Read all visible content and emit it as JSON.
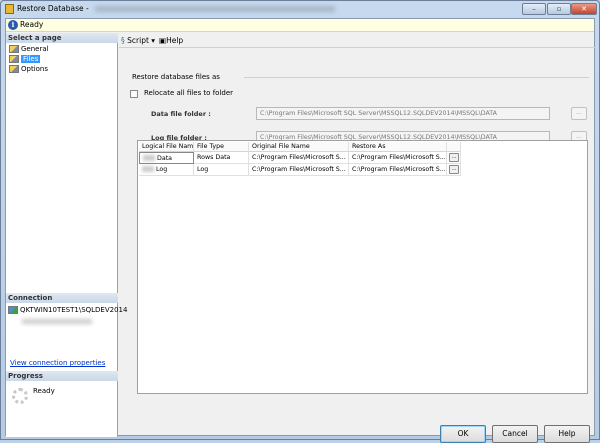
{
  "window": {
    "title": "Restore Database - "
  },
  "status": {
    "text": "Ready"
  },
  "left": {
    "select_header": "Select a page",
    "pages": [
      {
        "label": "General"
      },
      {
        "label": "Files"
      },
      {
        "label": "Options"
      }
    ],
    "connection_header": "Connection",
    "server": "QKTWIN10TEST1\\SQLDEV2014",
    "view_link": "View connection properties",
    "progress_header": "Progress",
    "progress_status": "Ready"
  },
  "toolbar": {
    "script": "Script",
    "help": "Help"
  },
  "files": {
    "group_label": "Restore database files as",
    "relocate_label": "Relocate all files to folder",
    "data_folder_label": "Data file folder :",
    "data_folder_value": "C:\\Program Files\\Microsoft SQL Server\\MSSQL12.SQLDEV2014\\MSSQL\\DATA",
    "log_folder_label": "Log file folder :",
    "log_folder_value": "C:\\Program Files\\Microsoft SQL Server\\MSSQL12.SQLDEV2014\\MSSQL\\DATA",
    "browse": "..."
  },
  "grid": {
    "headers": [
      "Logical File Name",
      "File Type",
      "Original File Name",
      "Restore As"
    ],
    "rows": [
      {
        "logical": "Data",
        "type": "Rows Data",
        "original": "C:\\Program Files\\Microsoft S...",
        "restore": "C:\\Program Files\\Microsoft S...",
        "btn": "..."
      },
      {
        "logical": "Log",
        "type": "Log",
        "original": "C:\\Program Files\\Microsoft S...",
        "restore": "C:\\Program Files\\Microsoft S...",
        "btn": "..."
      }
    ]
  },
  "buttons": {
    "ok": "OK",
    "cancel": "Cancel",
    "help": "Help"
  }
}
